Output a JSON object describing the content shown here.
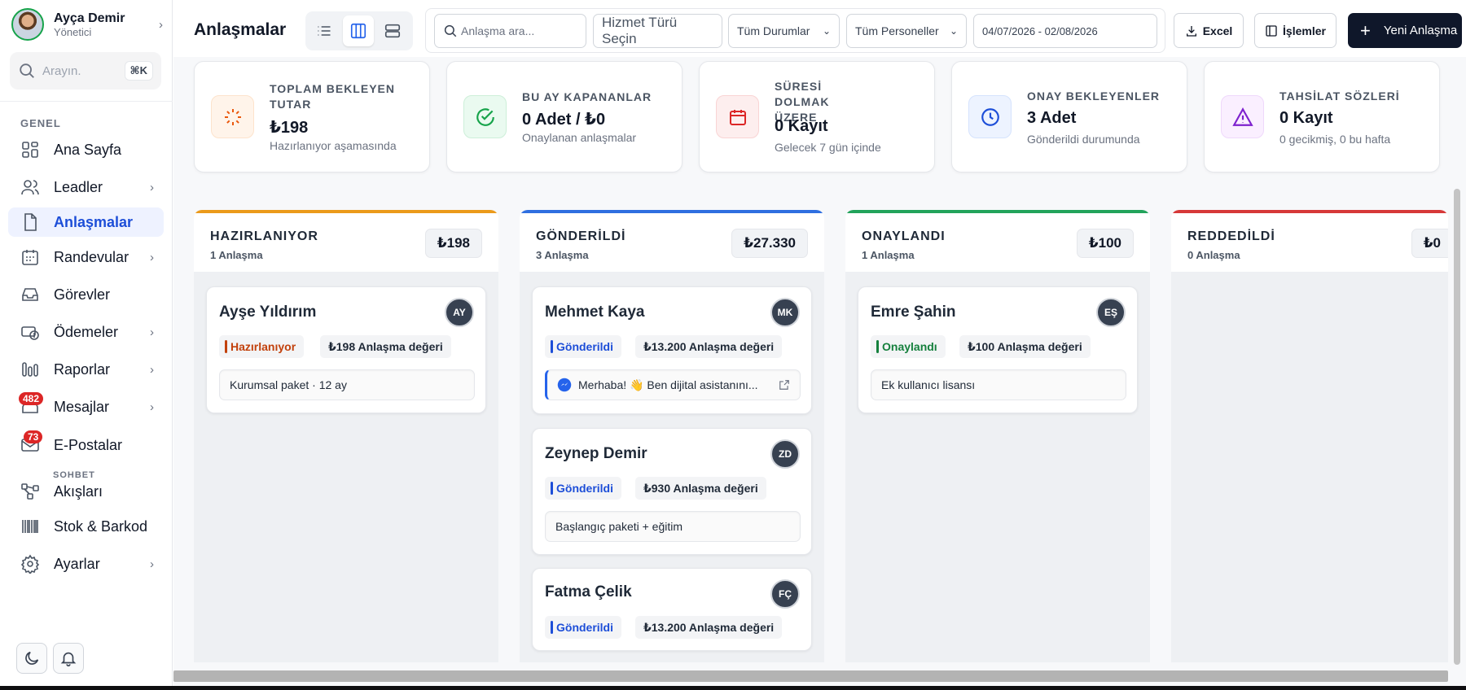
{
  "user": {
    "name": "Ayça Demir",
    "role": "Yönetici"
  },
  "search": {
    "placeholder": "Arayın.",
    "shortcut": "⌘K"
  },
  "sidebar": {
    "section": "GENEL",
    "items": [
      {
        "label": "Ana Sayfa",
        "icon": "grid-icon"
      },
      {
        "label": "Leadler",
        "icon": "users-icon"
      },
      {
        "label": "Anlaşmalar",
        "icon": "document-icon",
        "active": true
      },
      {
        "label": "Randevular",
        "icon": "calendar-icon"
      },
      {
        "label": "Görevler",
        "icon": "inbox-icon"
      },
      {
        "label": "Ödemeler",
        "icon": "payments-icon"
      },
      {
        "label": "Raporlar",
        "icon": "bar-chart-icon"
      },
      {
        "label": "Mesajlar",
        "icon": "message-icon",
        "badge": "482"
      },
      {
        "label": "E-Postalar",
        "icon": "mail-icon",
        "badge": "73"
      },
      {
        "label": "Akışları",
        "icon": "flow-icon",
        "sublabel": "SOHBET"
      },
      {
        "label": "Stok & Barkod",
        "icon": "barcode-icon"
      },
      {
        "label": "Ayarlar",
        "icon": "gear-icon"
      }
    ]
  },
  "header": {
    "title": "Anlaşmalar",
    "search_placeholder": "Anlaşma ara...",
    "service_placeholder": "Hizmet Türü Seçin",
    "status_filter": "Tüm Durumlar",
    "staff_filter": "Tüm Personeller",
    "date_range": "04/07/2026 - 02/08/2026",
    "excel": "Excel",
    "actions": "İşlemler",
    "new_deal": "Yeni Anlaşma"
  },
  "stats": [
    {
      "title": "TOPLAM BEKLEYEN TUTAR",
      "value": "₺198",
      "sub": "Hazırlanıyor aşamasında",
      "color": "#ea580c"
    },
    {
      "title": "BU AY KAPANANLAR",
      "value": "0 Adet / ₺0",
      "sub": "Onaylanan anlaşmalar",
      "color": "#16a34a"
    },
    {
      "title": "SÜRESİ DOLMAK ÜZERE",
      "value": "0 Kayıt",
      "sub": "Gelecek 7 gün içinde",
      "color": "#dc2626"
    },
    {
      "title": "ONAY BEKLEYENLER",
      "value": "3 Adet",
      "sub": "Gönderildi durumunda",
      "color": "#1d4ed8"
    },
    {
      "title": "TAHSİLAT SÖZLERİ",
      "value": "0 Kayıt",
      "sub": "0 gecikmiş, 0 bu hafta",
      "color": "#7e22ce"
    }
  ],
  "columns": [
    {
      "name": "HAZIRLANIYOR",
      "count": "1 Anlaşma",
      "amount": "₺198",
      "color": "#eb9a1b",
      "cards": [
        {
          "name": "Ayşe Yıldırım",
          "initials": "AY",
          "status": "Hazırlanıyor",
          "status_color": "#c2410c",
          "value": "₺198 Anlaşma değeri",
          "note": "Kurumsal paket · 12 ay"
        }
      ]
    },
    {
      "name": "GÖNDERİLDİ",
      "count": "3 Anlaşma",
      "amount": "₺27.330",
      "color": "#2f6fe0",
      "cards": [
        {
          "name": "Mehmet Kaya",
          "initials": "MK",
          "status": "Gönderildi",
          "status_color": "#1d4ed8",
          "value": "₺13.200 Anlaşma değeri",
          "note": "Merhaba! 👋 Ben dijital asistanını..."
        },
        {
          "name": "Zeynep Demir",
          "initials": "ZD",
          "status": "Gönderildi",
          "status_color": "#1d4ed8",
          "value": "₺930 Anlaşma değeri",
          "note": "Başlangıç paketi + eğitim"
        },
        {
          "name": "Fatma Çelik",
          "initials": "FÇ",
          "status": "Gönderildi",
          "status_color": "#1d4ed8",
          "value": "₺13.200 Anlaşma değeri",
          "note": ""
        }
      ]
    },
    {
      "name": "ONAYLANDI",
      "count": "1 Anlaşma",
      "amount": "₺100",
      "color": "#22a35b",
      "cards": [
        {
          "name": "Emre Şahin",
          "initials": "EŞ",
          "status": "Onaylandı",
          "status_color": "#15803d",
          "value": "₺100 Anlaşma değeri",
          "note": "Ek kullanıcı lisansı"
        }
      ]
    },
    {
      "name": "REDDEDİLDİ",
      "count": "0 Anlaşma",
      "amount": "₺0",
      "color": "#d63838",
      "cards": []
    }
  ]
}
